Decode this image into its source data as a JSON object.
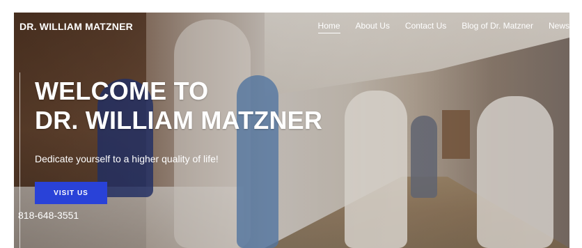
{
  "header": {
    "brand": "DR. WILLIAM MATZNER",
    "nav": [
      {
        "label": "Home",
        "active": true
      },
      {
        "label": "About Us",
        "active": false
      },
      {
        "label": "Contact Us",
        "active": false
      },
      {
        "label": "Blog of Dr. Matzner",
        "active": false
      },
      {
        "label": "News",
        "active": false
      }
    ]
  },
  "hero": {
    "headline_line1": "WELCOME TO",
    "headline_line2": "DR. WILLIAM MATZNER",
    "subhead": "Dedicate yourself to a higher quality of life!",
    "cta_label": "VISIT US",
    "phone": "818-648-3551"
  },
  "colors": {
    "cta_background": "#2942d8",
    "text": "#ffffff"
  }
}
